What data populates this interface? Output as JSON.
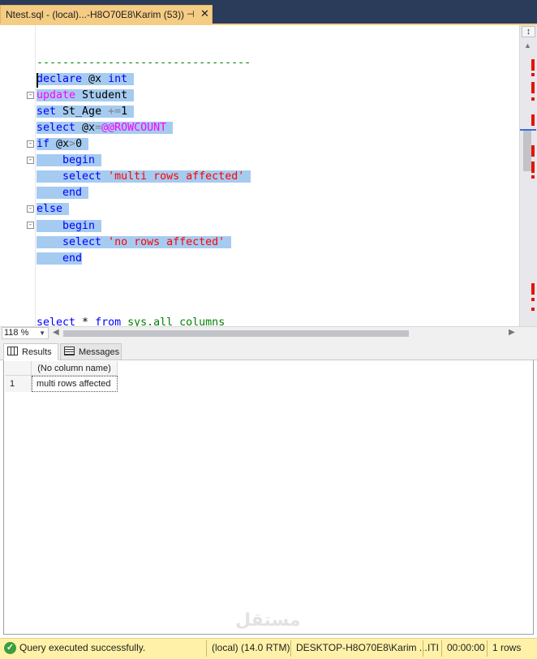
{
  "tab": {
    "title": "Ntest.sql - (local)...-H8O70E8\\Karim (53))",
    "pin_icon": "pin-icon",
    "close_icon": "close-icon"
  },
  "editor": {
    "comment": "---------------------------------",
    "code": {
      "declare": "declare",
      "declare_var": " @x ",
      "int": "int",
      "update": "update",
      "update_table": " Student",
      "set": "set",
      "set_col": " St_Age ",
      "set_op": "+=",
      "set_val": "1",
      "select1": "select",
      "select1_var": " @x",
      "select1_eq": "=",
      "rowcount": "@@ROWCOUNT",
      "if": "if",
      "if_var": " @x",
      "if_gt": ">",
      "if_val": "0",
      "begin1": "begin",
      "select2": "select",
      "str1": "'multi rows affected'",
      "end1": "end",
      "else": "else",
      "begin2": "begin",
      "select3": "select",
      "str2": "'no rows affected'",
      "end2": "end",
      "last_select": "select",
      "last_star": " * ",
      "last_from": "from",
      "last_obj": " sys.all_columns"
    }
  },
  "zoom": {
    "level": "118 %"
  },
  "results_tabs": {
    "results": "Results",
    "messages": "Messages"
  },
  "results_grid": {
    "columns": [
      "(No column name)"
    ],
    "rows": [
      {
        "num": "1",
        "values": [
          "multi rows affected"
        ]
      }
    ]
  },
  "watermark": "مستقل",
  "status_bar": {
    "message": "Query executed successfully.",
    "server": "(local) (14.0 RTM)",
    "connection": "DESKTOP-H8O70E8\\Karim ...",
    "mode": "ITI",
    "elapsed": "00:00:00",
    "rows": "1 rows"
  },
  "colors": {
    "tab_active": "#f5cc84",
    "selection": "#a6cbf0",
    "keyword": "#0000ff",
    "system_function": "#ff00ff",
    "string": "#ff0000",
    "comment": "#008000",
    "status_bar": "#fff2a8",
    "error_marker": "#e51400"
  }
}
